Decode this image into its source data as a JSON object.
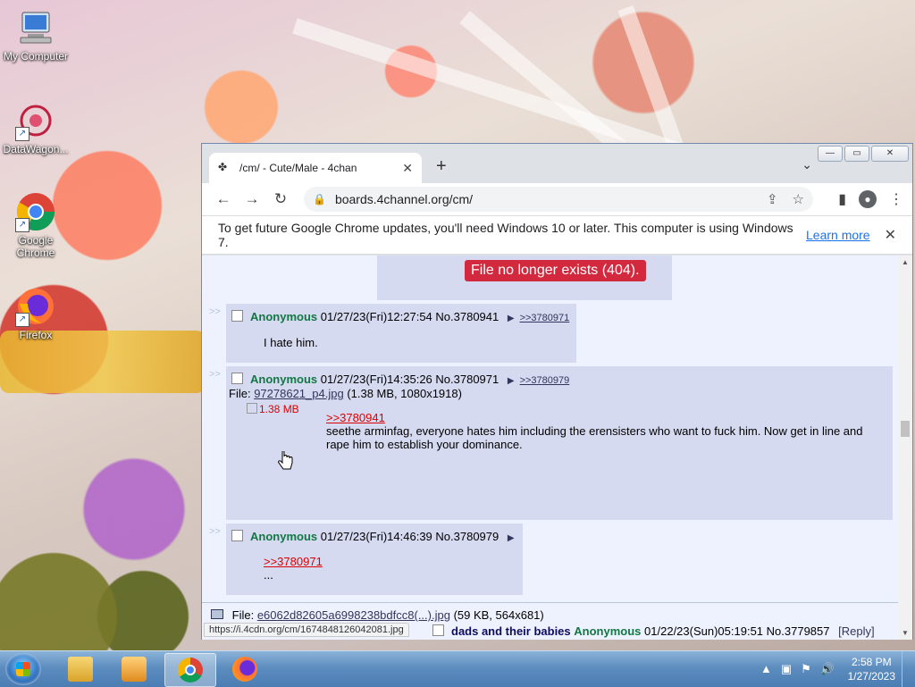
{
  "desktop": {
    "icons": [
      {
        "label": "My Computer",
        "icon": "computer-icon"
      },
      {
        "label": "DataWagon...",
        "icon": "datawagon-icon"
      },
      {
        "label": "Google Chrome",
        "icon": "chrome-icon"
      },
      {
        "label": "Firefox",
        "icon": "firefox-icon"
      }
    ]
  },
  "window": {
    "controls": {
      "minimize": "—",
      "maximize": "▭",
      "close": "✕"
    }
  },
  "browser": {
    "tab_title": "/cm/ - Cute/Male - 4chan",
    "tab_close": "✕",
    "new_tab": "+",
    "tab_menu": "⌄",
    "url": "boards.4channel.org/cm/",
    "infobar": {
      "message": "To get future Google Chrome updates, you'll need Windows 10 or later. This computer is using Windows 7.",
      "learn_more": "Learn more",
      "close": "✕"
    },
    "status_url": "https://i.4cdn.org/cm/1674848126042081.jpg"
  },
  "page": {
    "error_badge": "File no longer exists (404).",
    "posts": [
      {
        "name": "Anonymous",
        "datetime": "01/27/23(Fri)12:27:54",
        "number": "No.3780941",
        "backlink": ">>3780971",
        "text": "I hate him."
      },
      {
        "name": "Anonymous",
        "datetime": "01/27/23(Fri)14:35:26",
        "number": "No.3780971",
        "backlink": ">>3780979",
        "file_label": "File:",
        "file_name": "97278621_p4.jpg",
        "file_info": "(1.38 MB, 1080x1918)",
        "thumb_alt": "1.38 MB",
        "quote": ">>3780941",
        "text": "seethe arminfag, everyone hates him including the erensisters who want to fuck him. Now get in line and rape him to establish your dominance."
      },
      {
        "name": "Anonymous",
        "datetime": "01/27/23(Fri)14:46:39",
        "number": "No.3780979",
        "quote": ">>3780971",
        "text": "..."
      }
    ],
    "next_thread": {
      "file_label": "File:",
      "file_name": "e6062d82605a6998238bdfcc8(...).jpg",
      "file_info": "(59 KB, 564x681)",
      "subject": "dads and their babies",
      "name": "Anonymous",
      "datetime": "01/22/23(Sun)05:19:51",
      "number": "No.3779857",
      "reply": "[Reply]"
    },
    "arrows": ">>"
  },
  "taskbar": {
    "time": "2:58 PM",
    "date": "1/27/2023"
  },
  "colors": {
    "post_bg": "#d6daf0",
    "page_bg": "#eef2ff",
    "name_green": "#117743",
    "quote_red": "#dd0000",
    "error_red": "#d2293e"
  }
}
